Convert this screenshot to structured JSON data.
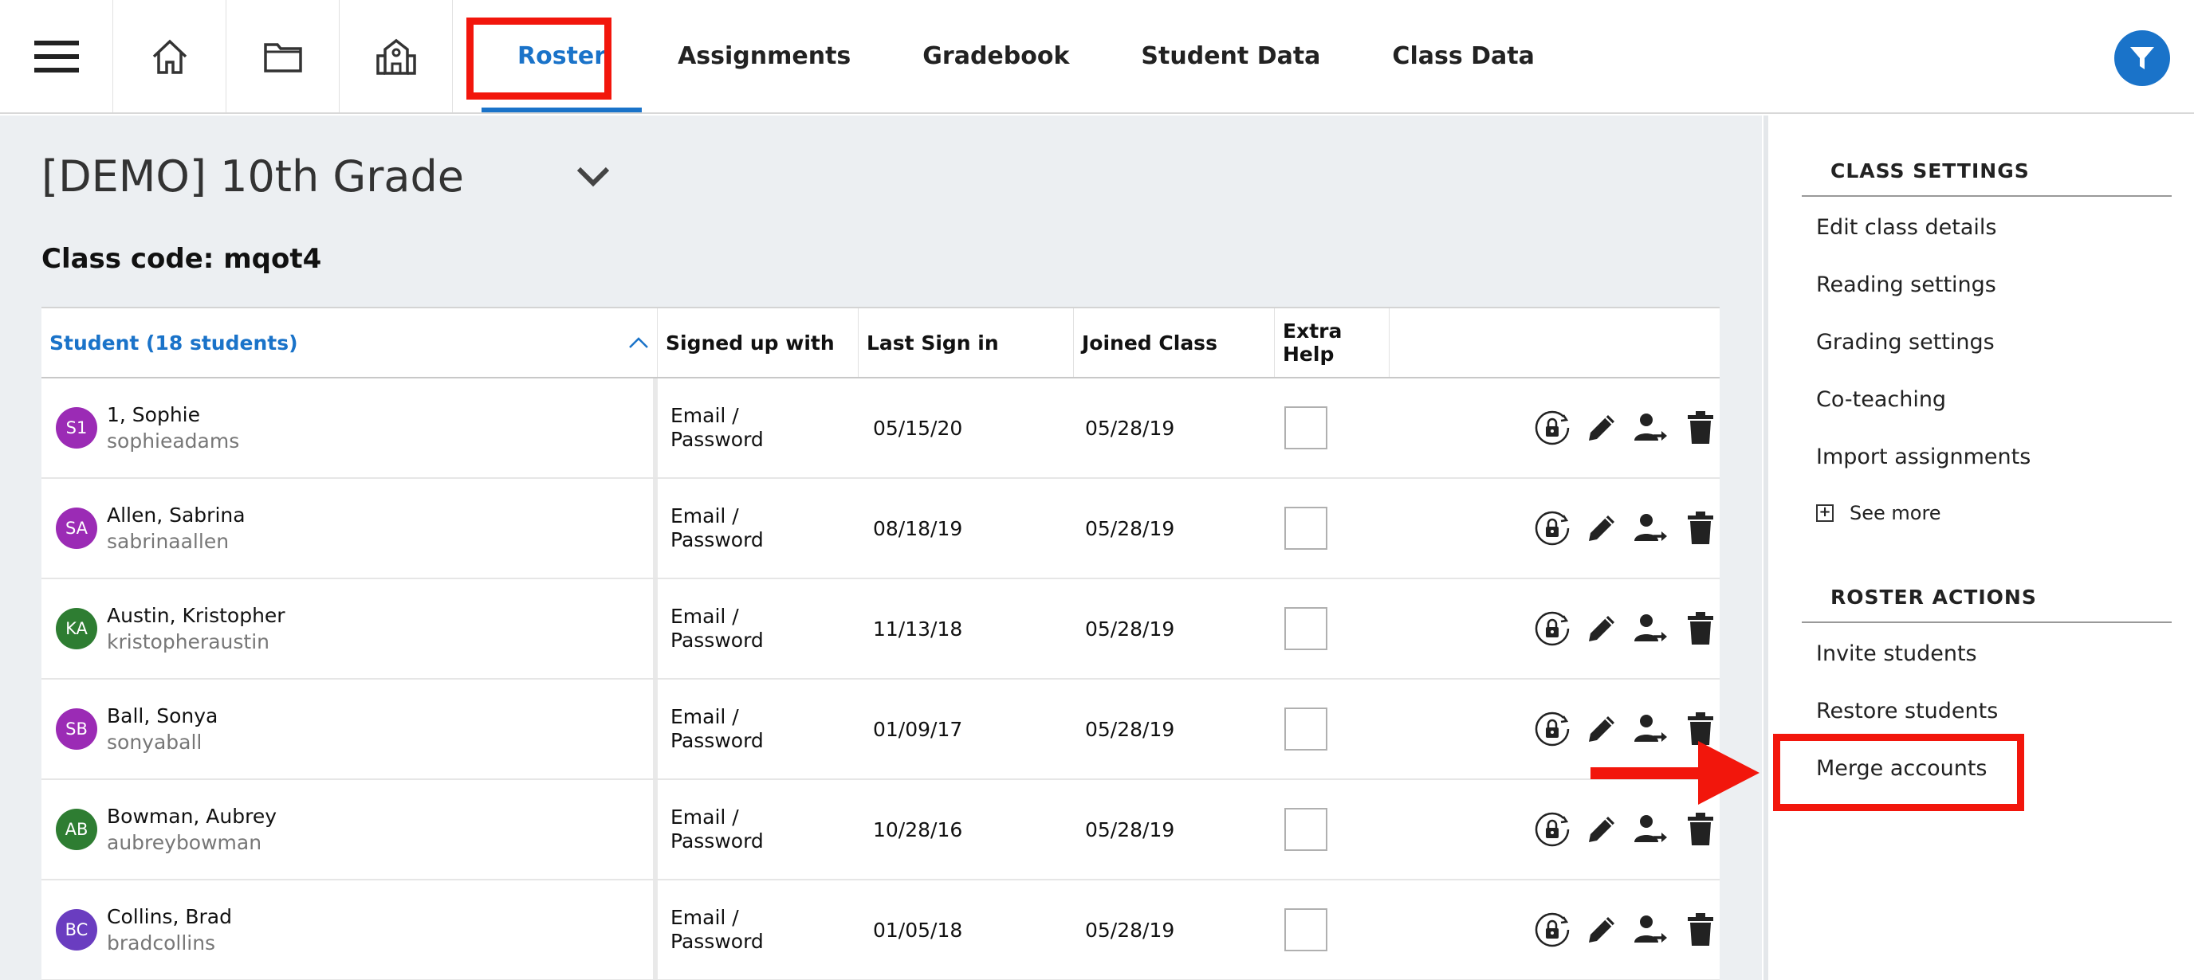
{
  "nav": {
    "icons": [
      "hamburger-icon",
      "home-icon",
      "folder-icon",
      "school-icon"
    ],
    "tabs": [
      {
        "label": "Roster",
        "active": true
      },
      {
        "label": "Assignments",
        "active": false
      },
      {
        "label": "Gradebook",
        "active": false
      },
      {
        "label": "Student Data",
        "active": false
      },
      {
        "label": "Class Data",
        "active": false
      }
    ],
    "accent": "#1a73c9"
  },
  "class": {
    "title": "[DEMO] 10th Grade",
    "code": "Class code: mqot4"
  },
  "table": {
    "headers": {
      "student": "Student (18 students)",
      "signed": "Signed up with",
      "last": "Last Sign in",
      "joined": "Joined Class",
      "extra": "Extra Help"
    },
    "rows": [
      {
        "initials": "S1",
        "color": "#9b2bb5",
        "name": "1, Sophie",
        "username": "sophieadams",
        "signed_line1": "Email /",
        "signed_line2": "Password",
        "last": "05/15/20",
        "joined": "05/28/19"
      },
      {
        "initials": "SA",
        "color": "#9b2bb5",
        "name": "Allen, Sabrina",
        "username": "sabrinaallen",
        "signed_line1": "Email /",
        "signed_line2": "Password",
        "last": "08/18/19",
        "joined": "05/28/19"
      },
      {
        "initials": "KA",
        "color": "#2e7d32",
        "name": "Austin, Kristopher",
        "username": "kristopheraustin",
        "signed_line1": "Email /",
        "signed_line2": "Password",
        "last": "11/13/18",
        "joined": "05/28/19"
      },
      {
        "initials": "SB",
        "color": "#9b2bb5",
        "name": "Ball, Sonya",
        "username": "sonyaball",
        "signed_line1": "Email /",
        "signed_line2": "Password",
        "last": "01/09/17",
        "joined": "05/28/19"
      },
      {
        "initials": "AB",
        "color": "#2e7d32",
        "name": "Bowman, Aubrey",
        "username": "aubreybowman",
        "signed_line1": "Email /",
        "signed_line2": "Password",
        "last": "10/28/16",
        "joined": "05/28/19"
      },
      {
        "initials": "BC",
        "color": "#6a3dc0",
        "name": "Collins, Brad",
        "username": "bradcollins",
        "signed_line1": "Email /",
        "signed_line2": "Password",
        "last": "01/05/18",
        "joined": "05/28/19"
      }
    ],
    "row_actions": [
      "reset-password-icon",
      "edit-pencil-icon",
      "move-student-icon",
      "trash-icon"
    ]
  },
  "sidebar": {
    "class_settings_title": "CLASS SETTINGS",
    "class_settings": [
      "Edit class details",
      "Reading settings",
      "Grading settings",
      "Co-teaching",
      "Import assignments"
    ],
    "see_more": "See more",
    "roster_actions_title": "ROSTER ACTIONS",
    "roster_actions": [
      "Invite students",
      "Restore students",
      "Merge accounts"
    ]
  },
  "annotation_color": "#f2160c"
}
